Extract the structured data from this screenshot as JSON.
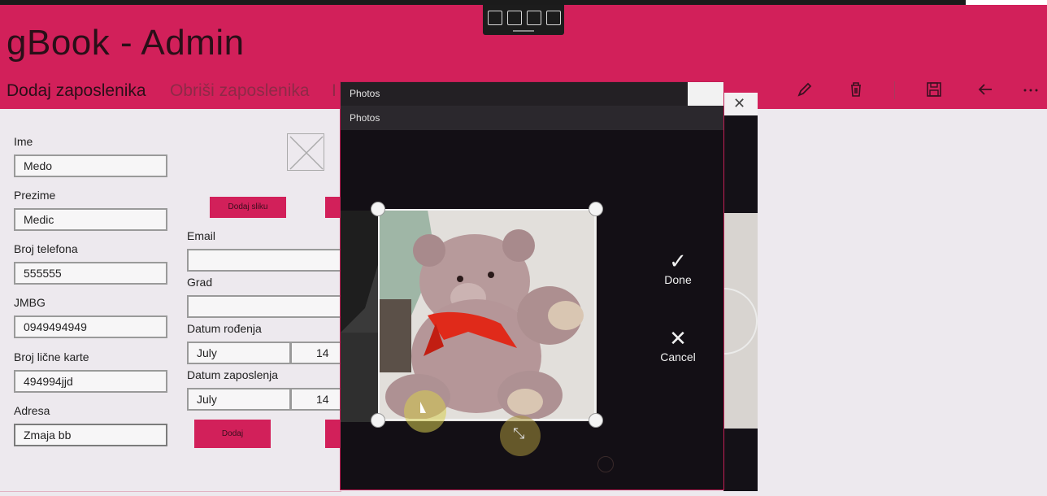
{
  "app": {
    "title": "gBook - Admin"
  },
  "commands": {
    "add_employee": "Dodaj zaposlenika",
    "delete_employee": "Obriši zaposlenika",
    "toolbar_icons": [
      "pencil-icon",
      "trash-icon",
      "save-icon",
      "back-arrow-icon",
      "more-icon"
    ]
  },
  "overlay_toolbar": {
    "icons": [
      "snip-icon",
      "select-icon",
      "window-icon",
      "crop-icon"
    ]
  },
  "form": {
    "ime": {
      "label": "Ime",
      "value": "Medo"
    },
    "prezime": {
      "label": "Prezime",
      "value": "Medic"
    },
    "telefon": {
      "label": "Broj telefona",
      "value": "555555"
    },
    "jmbg": {
      "label": "JMBG",
      "value": "0949494949"
    },
    "licna_karta": {
      "label": "Broj lične karte",
      "value": "494994jjd"
    },
    "adresa": {
      "label": "Adresa",
      "value": "Zmaja bb"
    },
    "email": {
      "label": "Email",
      "value": ""
    },
    "grad": {
      "label": "Grad",
      "value": ""
    },
    "datum_rodjenja": {
      "label": "Datum rođenja",
      "month": "July",
      "day": "14"
    },
    "datum_zaposlenja": {
      "label": "Datum zaposlenja",
      "month": "July",
      "day": "14"
    },
    "add_image_button": "Dodaj sliku",
    "submit_button": "Dodaj"
  },
  "photos_dialog": {
    "window_title": "Photos",
    "app_title": "Photos",
    "done_label": "Done",
    "cancel_label": "Cancel"
  },
  "colors": {
    "accent": "#d2205a",
    "dialog_bg": "#130f15",
    "page_bg": "#ede9ee"
  }
}
